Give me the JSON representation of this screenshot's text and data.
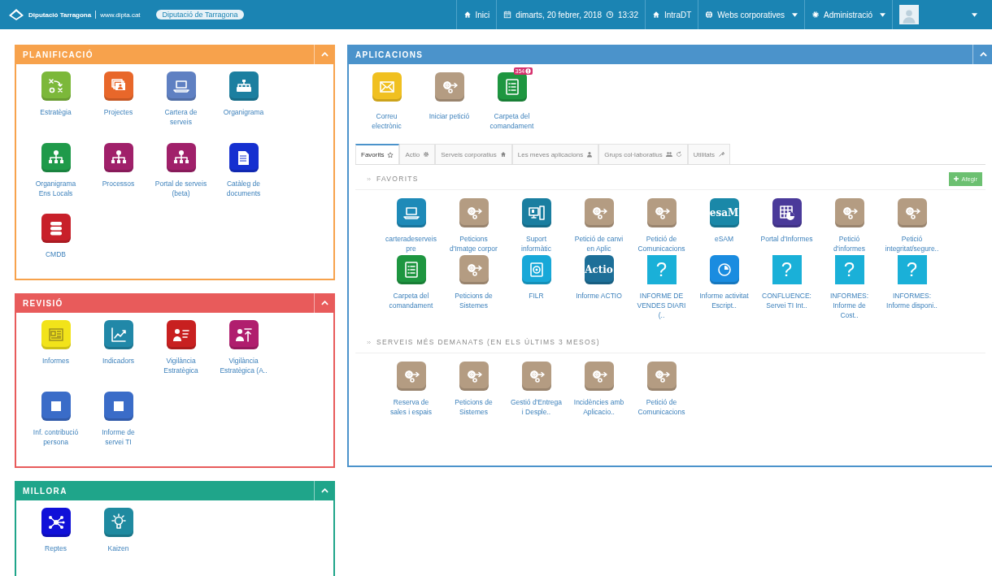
{
  "top_bar": {
    "brand": "Diputació Tarragona",
    "site": "www.dipta.cat",
    "pill": "Diputació de Tarragona",
    "nav": [
      {
        "kind": "link",
        "label": "Inici"
      },
      {
        "kind": "date",
        "label": "dimarts, 20 febrer, 2018",
        "time": "13:32"
      },
      {
        "kind": "link",
        "label": "IntraDT"
      },
      {
        "kind": "menu",
        "label": "Webs corporatives"
      },
      {
        "kind": "menu",
        "label": "Administració"
      },
      {
        "kind": "user"
      }
    ]
  },
  "panels": [
    {
      "title": "PLANIFICACIÓ",
      "color": "#f7a24c",
      "tiles": [
        {
          "label": "Estratègia",
          "kind": "strategy",
          "color": "#7cb83a"
        },
        {
          "label": "Projectes",
          "kind": "slides",
          "color": "#e8672a"
        },
        {
          "label": "Cartera de serveis",
          "kind": "laptop",
          "color": "#5f80c2"
        },
        {
          "label": "Organigrama",
          "kind": "orgchart",
          "color": "#1c7fa0"
        },
        {
          "label": "Organigrama Ens Locals",
          "kind": "hierarchy",
          "color": "#1f9a4a"
        },
        {
          "label": "Processos",
          "kind": "hierarchy",
          "color": "#a0206a"
        },
        {
          "label": "Portal de serveis (beta)",
          "kind": "hierarchy",
          "color": "#a0206a"
        },
        {
          "label": "Catàleg de documents",
          "kind": "document",
          "color": "#1530d0"
        },
        {
          "label": "CMDB",
          "kind": "database",
          "color": "#c8202a"
        }
      ]
    },
    {
      "title": "REVISIÓ",
      "color": "#e85b5b",
      "tiles": [
        {
          "label": "Informes",
          "kind": "report",
          "color": "#f2e31a"
        },
        {
          "label": "Indicadors",
          "kind": "linechart",
          "color": "#2188a8"
        },
        {
          "label": "Vigilància Estratègica",
          "kind": "personlist",
          "color": "#c82020"
        },
        {
          "label": "Vigilància Estratègica (A..",
          "kind": "personup",
          "color": "#b01e6e"
        },
        {
          "label": "Inf. contribució persona",
          "kind": "note",
          "color": "#3a6cc8"
        },
        {
          "label": "Informe de servei TI",
          "kind": "note",
          "color": "#3a6cc8"
        }
      ]
    },
    {
      "title": "MILLORA",
      "color": "#1fa58a",
      "tiles": [
        {
          "label": "Reptes",
          "kind": "network",
          "color": "#1010d8"
        },
        {
          "label": "Kaizen",
          "kind": "bulb",
          "color": "#1f8aa0"
        }
      ]
    }
  ],
  "aplicacions": {
    "title": "APLICACIONS",
    "color": "#4b93cb",
    "launchers": [
      {
        "label": "Correu electrònic",
        "kind": "mail",
        "color": "#f0c020"
      },
      {
        "label": "Iniciar petició",
        "kind": "gear",
        "color": "#b49c82"
      },
      {
        "label": "Carpeta del comandament",
        "kind": "checklist",
        "color": "#1e9640",
        "badge": "354"
      }
    ],
    "tabs": [
      {
        "label": "Favorits",
        "selected": true
      },
      {
        "label": "Actio",
        "selected": false
      },
      {
        "label": "Serveis corporatius",
        "selected": false
      },
      {
        "label": "Les meves aplicacions",
        "selected": false
      },
      {
        "label": "Grups col·laboratius",
        "selected": false
      },
      {
        "label": "Utilitats",
        "selected": false
      }
    ],
    "sections": [
      {
        "title": "FAVORITS",
        "button": "Afegir",
        "tiles": [
          {
            "label": "carteradeserveis pre",
            "kind": "laptop",
            "color": "#1e8ab8"
          },
          {
            "label": "Peticions d'Imatge corpor",
            "kind": "gear",
            "color": "#b49c82"
          },
          {
            "label": "Suport informàtic",
            "kind": "monitor",
            "color": "#1a7ea0"
          },
          {
            "label": "Petició de canvi en Aplic",
            "kind": "gear",
            "color": "#b49c82"
          },
          {
            "label": "Petició de Comunicacions",
            "kind": "gear",
            "color": "#b49c82"
          },
          {
            "label": "eSAM",
            "kind": "logo",
            "logo": "esaM",
            "color": "#1a88a8"
          },
          {
            "label": "Portal d'Informes",
            "kind": "gridpie",
            "color": "#4a3a9a"
          },
          {
            "label": "Petició d'informes",
            "kind": "gear",
            "color": "#b49c82"
          },
          {
            "label": "Petició integritat/segure..",
            "kind": "gear",
            "color": "#b49c82"
          },
          {
            "label": "Carpeta del comandament",
            "kind": "checklist",
            "color": "#1e9640"
          },
          {
            "label": "Peticions de Sistemes",
            "kind": "gear",
            "color": "#b49c82"
          },
          {
            "label": "FILR",
            "kind": "disc",
            "color": "#18a8d8"
          },
          {
            "label": "Informe ACTIO",
            "kind": "logo",
            "logo": "Actio",
            "color": "#1d6f98"
          },
          {
            "label": "INFORME DE VENDES DIARI (..",
            "kind": "glyph",
            "logo": "?",
            "color": "#1ab0d8"
          },
          {
            "label": "Informe activitat Escript..",
            "kind": "pie",
            "color": "#1a8ce0"
          },
          {
            "label": "CONFLUENCE: Servei TI Int..",
            "kind": "glyph",
            "logo": "?",
            "color": "#1ab0d8"
          },
          {
            "label": "INFORMES: Informe de Cost..",
            "kind": "glyph",
            "logo": "?",
            "color": "#1ab0d8"
          },
          {
            "label": "INFORMES: Informe disponi..",
            "kind": "glyph",
            "logo": "?",
            "color": "#1ab0d8"
          }
        ]
      },
      {
        "title": "SERVEIS MÉS DEMANATS (EN ELS ÚLTIMS 3 MESOS)",
        "tiles": [
          {
            "label": "Reserva de sales i espais",
            "kind": "gear",
            "color": "#b49c82"
          },
          {
            "label": "Peticions de Sistemes",
            "kind": "gear",
            "color": "#b49c82"
          },
          {
            "label": "Gestió d'Entrega i Desple..",
            "kind": "gear",
            "color": "#b49c82"
          },
          {
            "label": "Incidències amb Aplicacio..",
            "kind": "gear",
            "color": "#b49c82"
          },
          {
            "label": "Petició de Comunicacions",
            "kind": "gear",
            "color": "#b49c82"
          }
        ]
      }
    ]
  }
}
